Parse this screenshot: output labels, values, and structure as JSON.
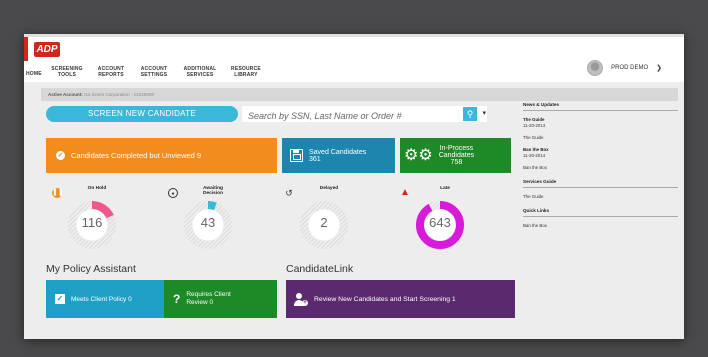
{
  "brand": {
    "logo_text": "ADP",
    "accent": "#d0271d"
  },
  "nav": [
    {
      "line1": "HOME",
      "line2": ""
    },
    {
      "line1": "SCREENING",
      "line2": "TOOLS"
    },
    {
      "line1": "ACCOUNT",
      "line2": "REPORTS"
    },
    {
      "line1": "ACCOUNT",
      "line2": "SETTINGS"
    },
    {
      "line1": "ADDITIONAL",
      "line2": "SERVICES"
    },
    {
      "line1": "RESOURCE",
      "line2": "LIBRARY"
    }
  ],
  "user": {
    "name": "PROD DEMO",
    "caret": "⌄"
  },
  "account": {
    "label": "Active Account:",
    "value": "Go Green Corporation - 12345000"
  },
  "screen_button": "SCREEN NEW CANDIDATE",
  "search": {
    "placeholder": "Search by SSN, Last Name or Order #",
    "icon": "search-icon"
  },
  "tiles": {
    "unviewed": "Candidates Completed but Unviewed 9",
    "saved": {
      "title": "Saved Candidates",
      "count": "361"
    },
    "inprocess": {
      "line1": "In-Process",
      "line2": "Candidates",
      "count": "758"
    }
  },
  "stats": [
    {
      "label1": "On Hold",
      "label2": "",
      "value": "116",
      "color": "#f0578a",
      "fraction": 0.18,
      "icon": "pause-icon"
    },
    {
      "label1": "Awaiting",
      "label2": "Decision",
      "value": "43",
      "color": "#3bb7d9",
      "fraction": 0.06,
      "icon": "target-icon"
    },
    {
      "label1": "Delayed",
      "label2": "",
      "value": "2",
      "color": "#9e9e9e",
      "fraction": 0.0,
      "icon": "history-icon"
    },
    {
      "label1": "Late",
      "label2": "",
      "value": "643",
      "color": "#d81bd8",
      "fraction": 0.92,
      "icon": "warning-icon"
    }
  ],
  "sections": {
    "policy": "My Policy Assistant",
    "candidatelink": "CandidateLink"
  },
  "policy_tiles": {
    "meets": "Meets Client Policy 0",
    "requires_l1": "Requires Client",
    "requires_l2": "Review 0"
  },
  "candidatelink_tile": "Review New Candidates and Start Screening 1",
  "sidebar": {
    "news_header": "News & Updates",
    "news": [
      {
        "title": "The Guide",
        "date": "11-20-2014"
      },
      {
        "title": "",
        "link": "The Guide"
      },
      {
        "title": "Ban the Box",
        "date": "11-20-2014"
      },
      {
        "title": "",
        "link": "Ban the Box"
      }
    ],
    "services_header": "Services Guide",
    "services_item": "The Guide",
    "quick_header": "Quick Links",
    "quick_item": "Ban the Box"
  }
}
